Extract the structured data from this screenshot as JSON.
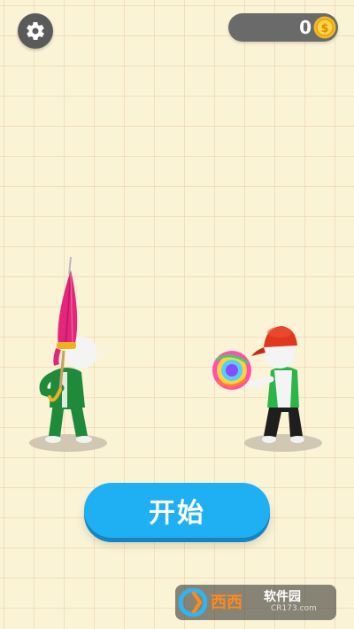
{
  "hud": {
    "coins": "0",
    "coin_symbol": "$"
  },
  "start_button": {
    "label": "开始"
  },
  "watermark": {
    "brand": "西西",
    "site_name": "软件园",
    "url": "CR173.com"
  },
  "colors": {
    "background": "#fbf3d6",
    "start_button": "#1fb0f4",
    "coin": "#f4b820",
    "umbrella": "#e3257b",
    "player_outfit": "#1f8a3a",
    "cap": "#e0381f"
  },
  "icons": [
    "gear-icon",
    "coin-icon",
    "umbrella",
    "lollipop",
    "cap"
  ]
}
